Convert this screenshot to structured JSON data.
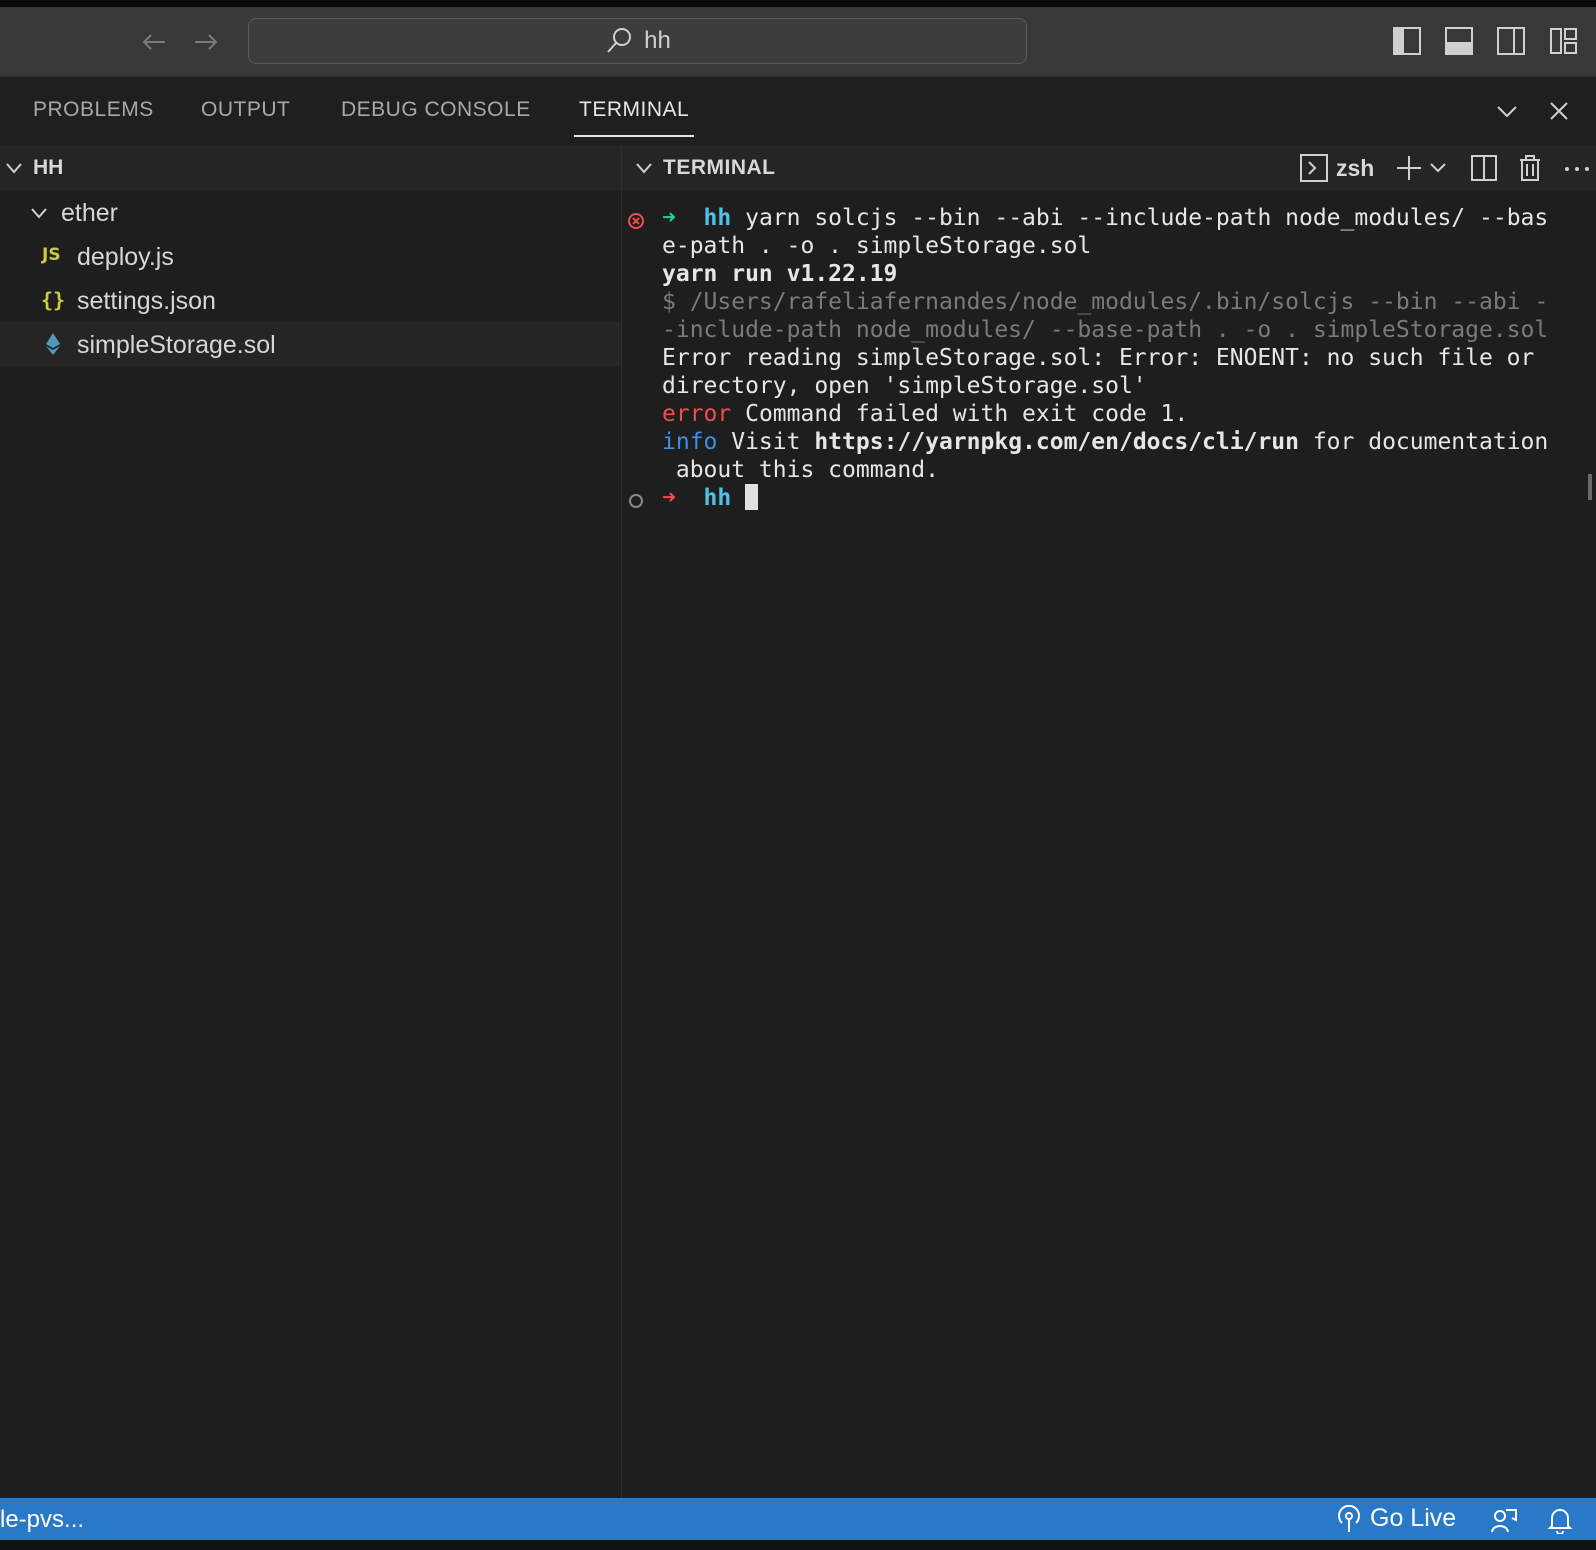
{
  "titlebar": {
    "search_text": "hh",
    "icons": [
      "arrow-left-icon",
      "arrow-right-icon",
      "search-icon",
      "toggle-primary-sidebar-icon",
      "toggle-panel-icon",
      "toggle-secondary-sidebar-icon",
      "customize-layout-icon"
    ]
  },
  "panel": {
    "tabs": [
      {
        "label": "PROBLEMS"
      },
      {
        "label": "OUTPUT"
      },
      {
        "label": "DEBUG CONSOLE"
      },
      {
        "label": "TERMINAL",
        "active": true
      }
    ]
  },
  "explorer": {
    "section_title": "HH",
    "folder": "ether",
    "files": [
      {
        "icon_text": "JS",
        "name": "deploy.js",
        "icon_color": "#cbcb41"
      },
      {
        "icon_text": "{}",
        "name": "settings.json",
        "icon_color": "#cbcb41"
      },
      {
        "icon_text": "",
        "name": "simpleStorage.sol",
        "icon_color": "#519aba"
      }
    ]
  },
  "terminal": {
    "section_title": "TERMINAL",
    "shell": "zsh",
    "lines": {
      "l1_dir": "hh",
      "l1_cmd": " yarn solcjs --bin --abi --include-path node_modules/ --bas",
      "l2": "e-path . -o . simpleStorage.sol",
      "l3": "yarn run v1.22.19",
      "l4": "$ /Users/rafeliafernandes/node_modules/.bin/solcjs --bin --abi -",
      "l5": "-include-path node_modules/ --base-path . -o . simpleStorage.sol",
      "l6": "Error reading simpleStorage.sol: Error: ENOENT: no such file or",
      "l7": "directory, open 'simpleStorage.sol'",
      "l8_tag": "error",
      "l8_rest": " Command failed with exit code 1.",
      "l9_tag": "info",
      "l9_mid": " Visit ",
      "l9_url": "https://yarnpkg.com/en/docs/cli/run",
      "l9_rest": " for documentation",
      "l10": " about this command.",
      "l11_dir": "hh"
    }
  },
  "statusbar": {
    "left_text": "le-pvs...",
    "go_live": "Go Live",
    "color": "#2a78c8"
  }
}
